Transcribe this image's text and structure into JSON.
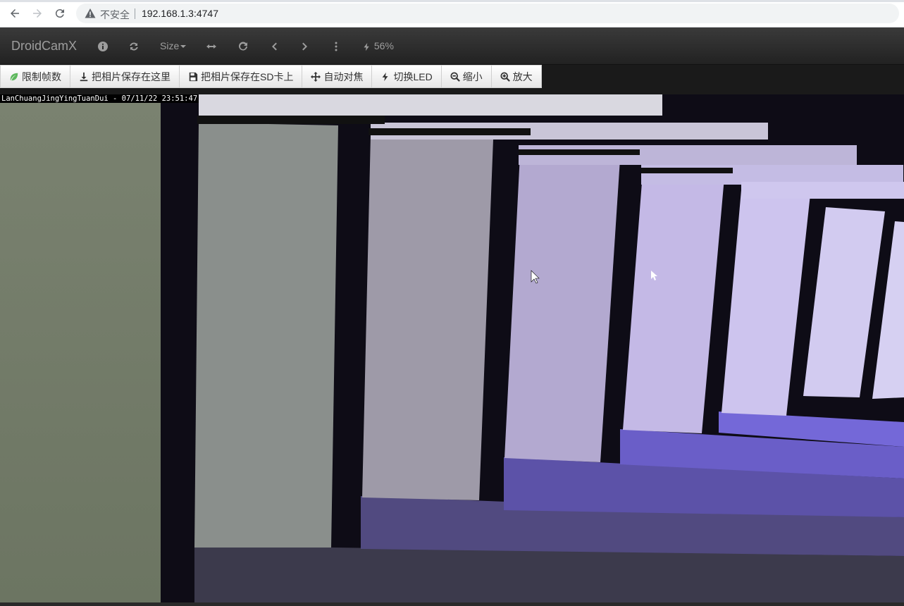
{
  "browser": {
    "security_label": "不安全",
    "url": "192.168.1.3:4747"
  },
  "navbar": {
    "brand": "DroidCamX",
    "size_label": "Size",
    "battery_label": "56%"
  },
  "toolbar": {
    "limit_fps": "限制帧数",
    "save_photo": "把相片保存在这里",
    "save_photo_sd": "把相片保存在SD卡上",
    "autofocus": "自动对焦",
    "toggle_led": "切换LED",
    "zoom_out": "缩小",
    "zoom_in": "放大"
  },
  "camera": {
    "overlay": "LanChuangJingYingTuanDui - 07/11/22 23:51:47"
  },
  "colors": {
    "navbar_text": "#9d9d9d",
    "leaf_icon": "#5cb85c"
  },
  "icons": [
    "back-icon",
    "forward-icon",
    "reload-icon",
    "warning-icon",
    "info-icon",
    "refresh-icon",
    "fit-width-icon",
    "rotate-icon",
    "prev-icon",
    "next-icon",
    "menu-dots-icon",
    "bolt-icon",
    "leaf-icon",
    "download-icon",
    "save-icon",
    "move-icon",
    "zoom-out-icon",
    "zoom-in-icon"
  ]
}
